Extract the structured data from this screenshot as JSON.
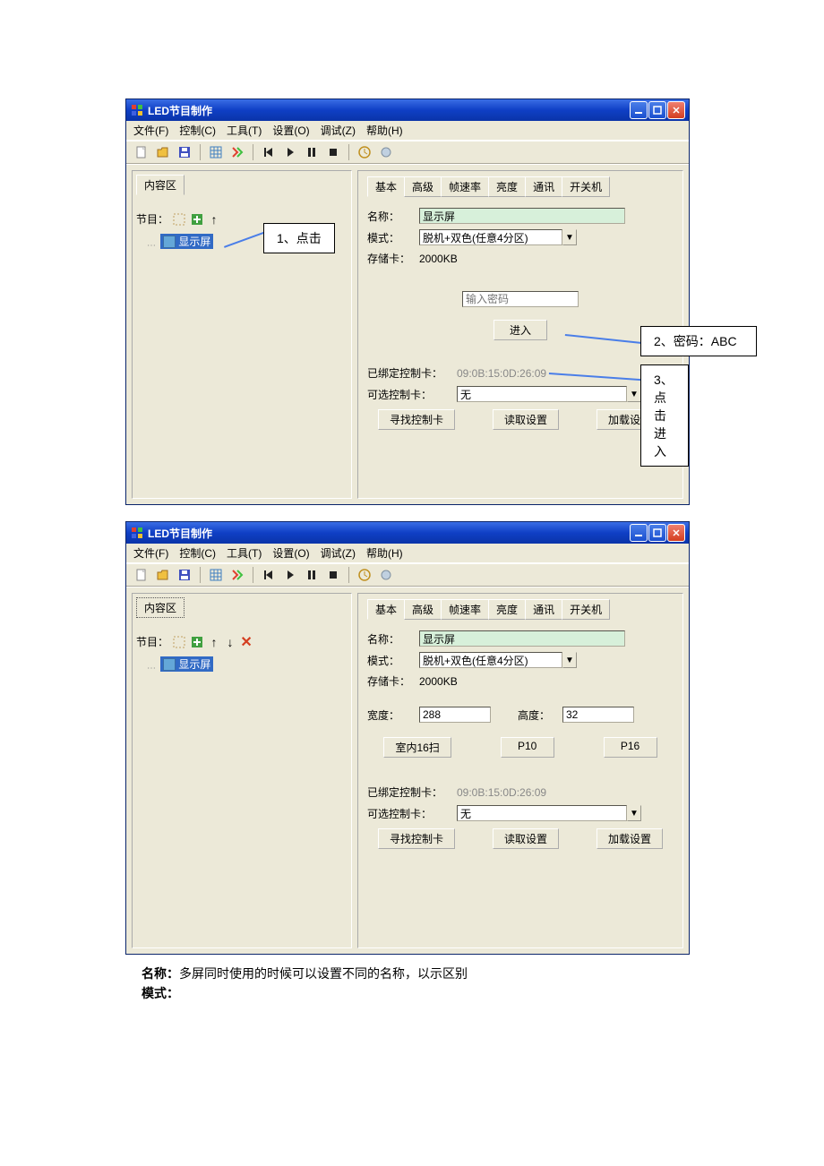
{
  "title": "LED节目制作",
  "menu": {
    "file": "文件(F)",
    "control": "控制(C)",
    "tools": "工具(T)",
    "settings": "设置(O)",
    "debug": "调试(Z)",
    "help": "帮助(H)"
  },
  "tabs": {
    "content_area": "内容区",
    "basic": "基本",
    "advanced": "高级",
    "framerate": "帧速率",
    "brightness": "亮度",
    "comm": "通讯",
    "switch": "开关机"
  },
  "left": {
    "program_label": "节目：",
    "display_item": "显示屏"
  },
  "form": {
    "name_label": "名称：",
    "name_value": "显示屏",
    "mode_label": "模式：",
    "mode_value": "脱机+双色(任意4分区)",
    "storage_label": "存储卡：",
    "storage_value": "2000KB",
    "password_placeholder": "输入密码",
    "enter_btn": "进入",
    "bound_label": "已绑定控制卡：",
    "bound_value": "09:0B:15:0D:26:09",
    "optional_label": "可选控制卡：",
    "optional_value": "无",
    "find_card": "寻找控制卡",
    "read_settings": "读取设置",
    "load_settings": "加载设置",
    "width_label": "宽度：",
    "width_value": "288",
    "height_label": "高度：",
    "height_value": "32",
    "indoor16": "室内16扫",
    "p10": "P10",
    "p16": "P16"
  },
  "callouts": {
    "click1": "1、点击",
    "password": "2、密码：ABC",
    "enter": "3、点击进入"
  },
  "footer": {
    "name_desc_label": "名称：",
    "name_desc": "多屏同时使用的时候可以设置不同的名称，以示区别",
    "mode_desc_label": "模式："
  }
}
